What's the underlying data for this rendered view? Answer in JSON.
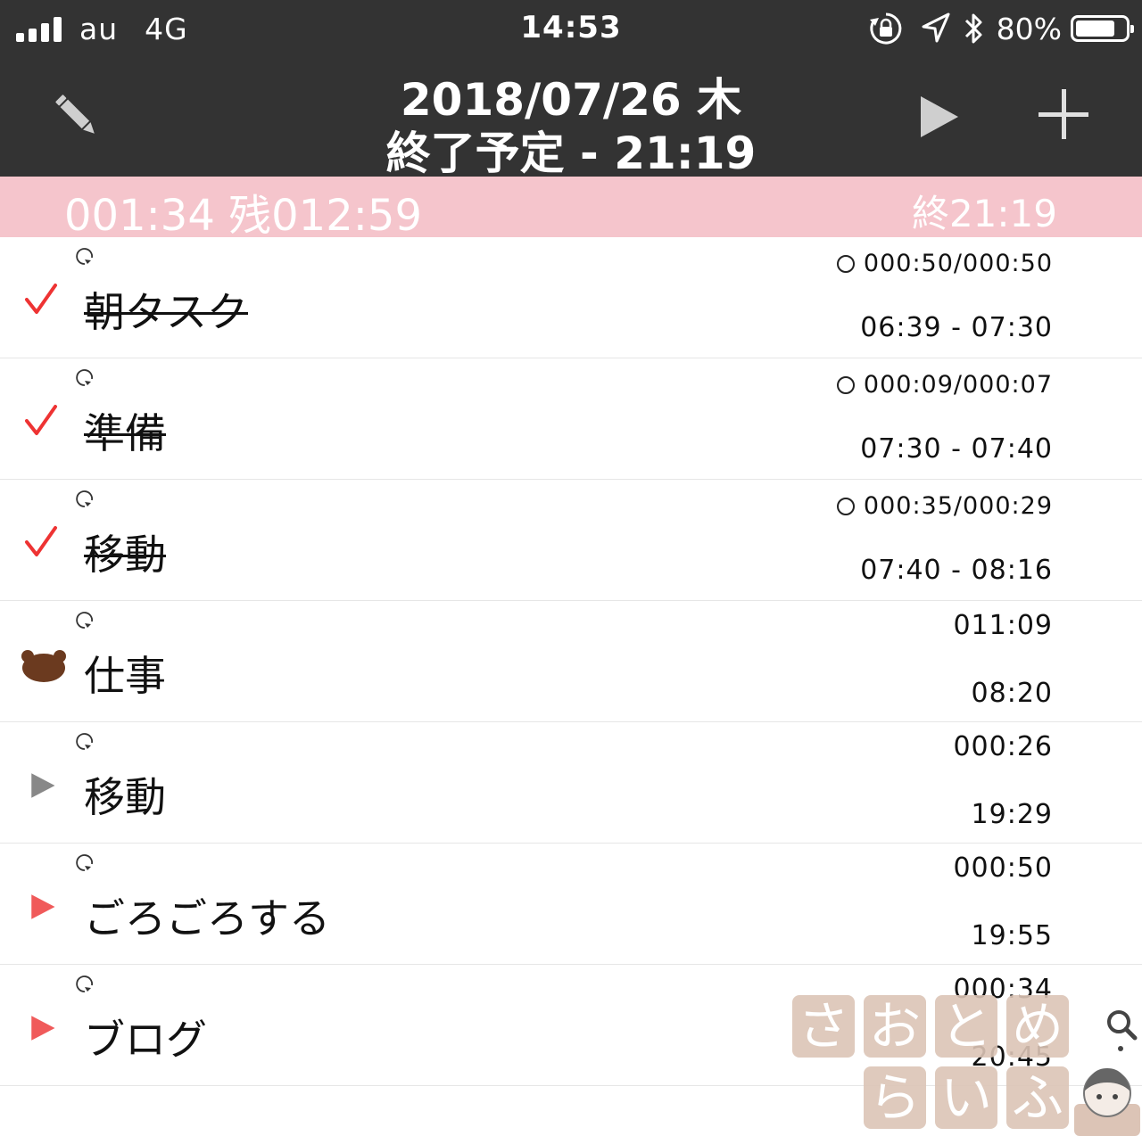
{
  "status_bar": {
    "carrier": "au",
    "network": "4G",
    "time": "14:53",
    "battery_percent": "80%",
    "battery_level": 0.8,
    "icons": [
      "signal-icon",
      "orientation-lock-icon",
      "location-icon",
      "bluetooth-icon",
      "battery-icon"
    ]
  },
  "header": {
    "date_line": "2018/07/26 木",
    "end_line": "終了予定 - 21:19",
    "icons": [
      "pencil-icon",
      "play-icon",
      "plus-icon"
    ]
  },
  "summary": {
    "elapsed": "001:34 残012:59",
    "end": "終21:19",
    "background": "#f5c5cc"
  },
  "tasks": [
    {
      "name": "朝タスク",
      "state": "done",
      "duration": "000:50/000:50",
      "time": "06:39 - 07:30",
      "timer_circle": true
    },
    {
      "name": "準備",
      "state": "done",
      "duration": "000:09/000:07",
      "time": "07:30 - 07:40",
      "timer_circle": true
    },
    {
      "name": "移動",
      "state": "done",
      "duration": "000:35/000:29",
      "time": "07:40 - 08:16",
      "timer_circle": true
    },
    {
      "name": "仕事",
      "state": "running",
      "duration": "011:09",
      "time": "08:20",
      "timer_circle": false
    },
    {
      "name": "移動",
      "state": "pending-gray",
      "duration": "000:26",
      "time": "19:29",
      "timer_circle": false
    },
    {
      "name": "ごろごろする",
      "state": "pending-red",
      "duration": "000:50",
      "time": "19:55",
      "timer_circle": false
    },
    {
      "name": "ブログ",
      "state": "pending-red",
      "duration": "000:34",
      "time": "20:45",
      "timer_circle": false
    }
  ],
  "watermark": {
    "text_row1": "さおとめ",
    "text_row2": "らいふ"
  },
  "colors": {
    "bar": "#333333",
    "check": "#ee3333",
    "play_red": "#f05a5a",
    "play_gray": "#888888",
    "bear": "#6b3a1f"
  }
}
